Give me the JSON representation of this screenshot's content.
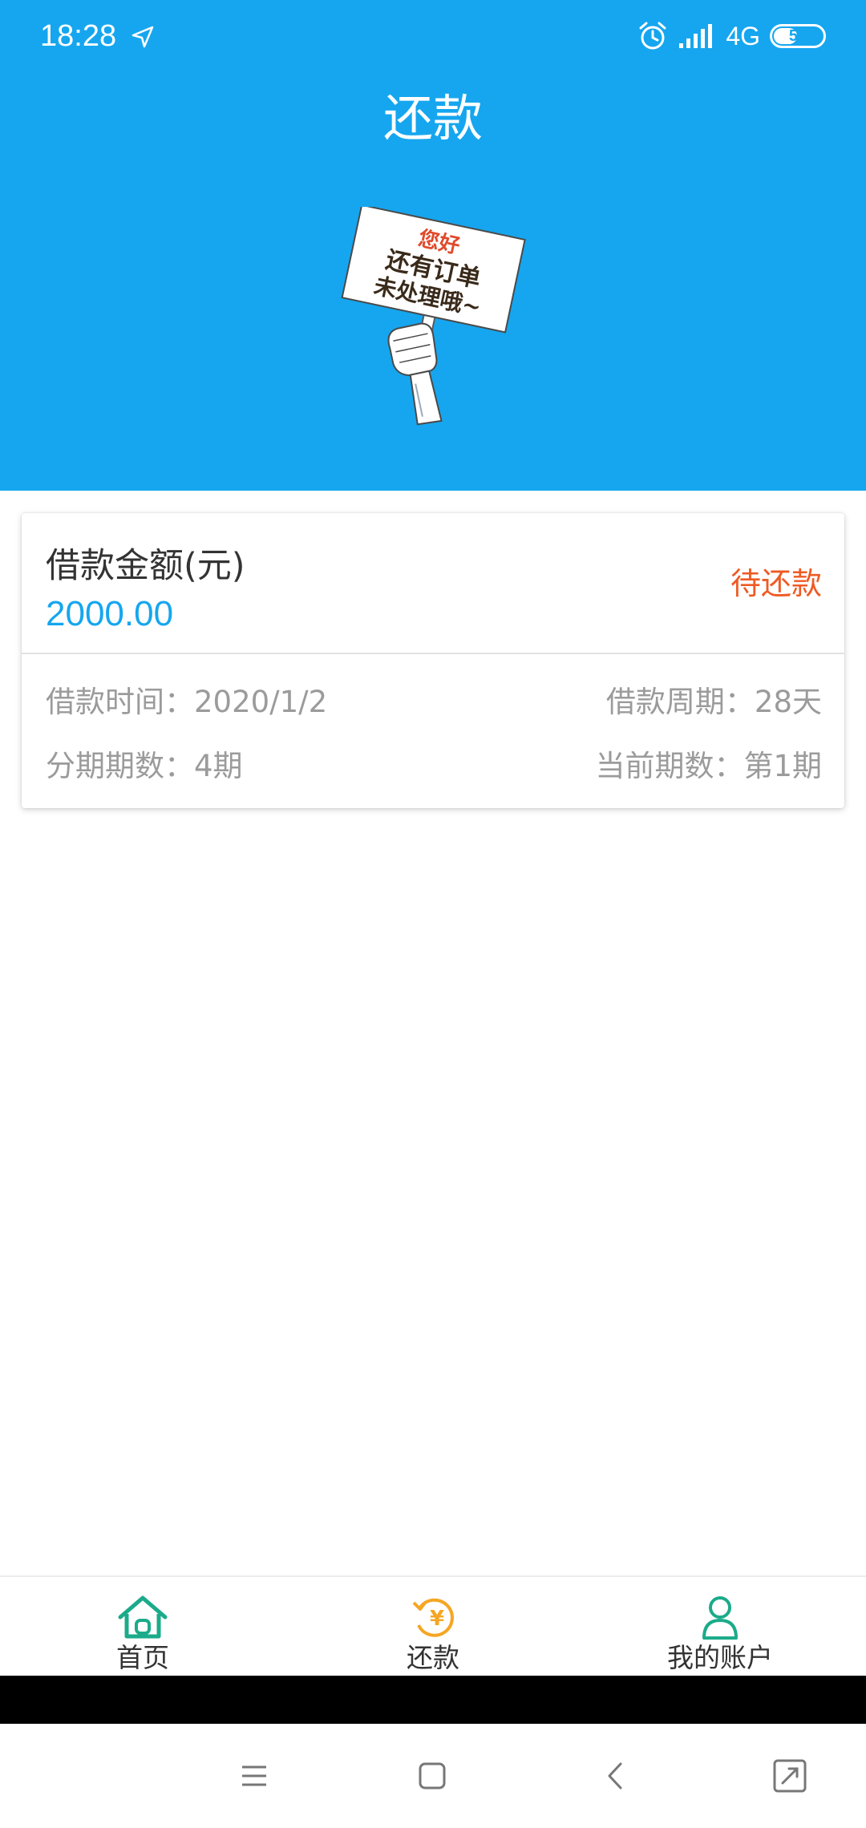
{
  "status_bar": {
    "time": "18:28",
    "network": "4G",
    "battery": "51",
    "battery_level_percent": 51
  },
  "header": {
    "title": "还款",
    "sign_lines": [
      "您好",
      "还有订单",
      "未处理哦~"
    ]
  },
  "loan_card": {
    "amount_label": "借款金额(元)",
    "amount_value": "2000.00",
    "status": "待还款",
    "loan_time": "借款时间：2020/1/2",
    "loan_period": "借款周期：28天",
    "installments": "分期期数：4期",
    "current_installment": "当前期数：第1期"
  },
  "tabbar": {
    "tabs": [
      {
        "label": "首页",
        "icon": "home-icon"
      },
      {
        "label": "还款",
        "icon": "repay-icon"
      },
      {
        "label": "我的账户",
        "icon": "user-icon"
      }
    ]
  },
  "colors": {
    "header_bg": "#16a6ef",
    "amount_blue": "#16a6ef",
    "status_orange": "#ef5a24",
    "tab_green": "#1bab8a",
    "tab_orange": "#f5a623"
  },
  "system_nav": [
    "menu-icon",
    "home-square-icon",
    "back-icon",
    "screenshot-icon"
  ]
}
